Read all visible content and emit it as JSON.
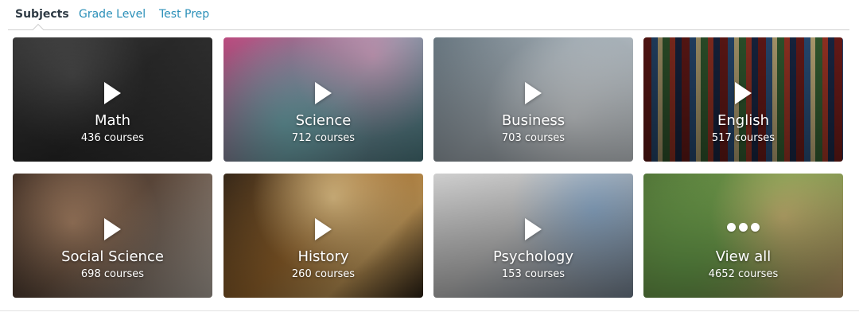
{
  "tabs": {
    "subjects": "Subjects",
    "grade_level": "Grade Level",
    "test_prep": "Test Prep",
    "active": "Subjects"
  },
  "cards": [
    {
      "title": "Math",
      "count": "436 courses",
      "icon": "play-icon"
    },
    {
      "title": "Science",
      "count": "712 courses",
      "icon": "play-icon"
    },
    {
      "title": "Business",
      "count": "703 courses",
      "icon": "play-icon"
    },
    {
      "title": "English",
      "count": "517 courses",
      "icon": "play-icon"
    },
    {
      "title": "Social Science",
      "count": "698 courses",
      "icon": "play-icon"
    },
    {
      "title": "History",
      "count": "260 courses",
      "icon": "play-icon"
    },
    {
      "title": "Psychology",
      "count": "153 courses",
      "icon": "play-icon"
    },
    {
      "title": "View all",
      "count": "4652 courses",
      "icon": "more-dots-icon"
    }
  ],
  "colors": {
    "tab_active": "#2f3b45",
    "tab_link": "#2a8fb8",
    "divider": "#cfcfcf",
    "text_on_card": "#ffffff"
  }
}
